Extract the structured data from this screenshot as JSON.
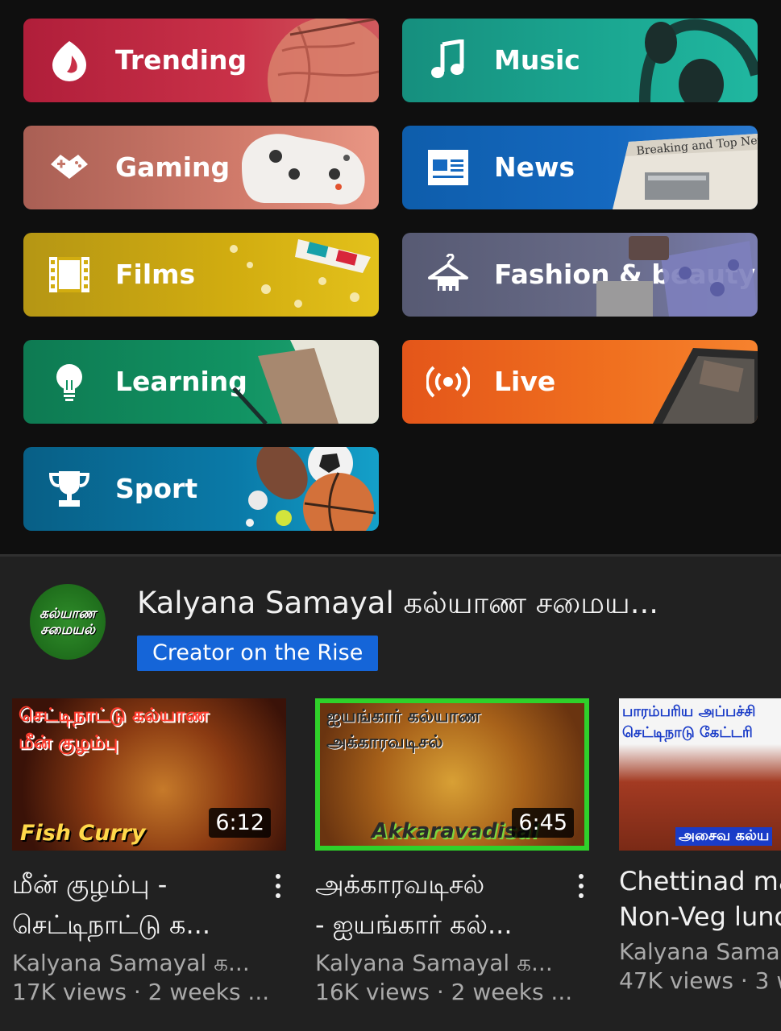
{
  "explore": {
    "tiles": [
      {
        "label": "Trending",
        "icon": "trending-flame-icon"
      },
      {
        "label": "Music",
        "icon": "music-note-icon"
      },
      {
        "label": "Gaming",
        "icon": "gamepad-icon"
      },
      {
        "label": "News",
        "icon": "newspaper-icon"
      },
      {
        "label": "Films",
        "icon": "film-strip-icon"
      },
      {
        "label": "Fashion & beauty",
        "icon": "hanger-icon"
      },
      {
        "label": "Learning",
        "icon": "lightbulb-icon"
      },
      {
        "label": "Live",
        "icon": "live-broadcast-icon"
      },
      {
        "label": "Sport",
        "icon": "trophy-icon"
      }
    ],
    "news_art_text": "Breaking and Top News"
  },
  "channel": {
    "avatar_text_1": "கல்யாண",
    "avatar_text_2": "சமையல்",
    "name": "Kalyana Samayal கல்யாண சமைய...",
    "badge": "Creator on the Rise"
  },
  "videos": [
    {
      "thumb_text_1": "செட்டிநாட்டு கல்யாண",
      "thumb_text_2": "மீன் குழம்பு",
      "thumb_text_3": "Fish Curry",
      "duration": "6:12",
      "title_line1": "மீன் குழம்பு -",
      "title_line2": "செட்டிநாட்டு க...",
      "channel": "Kalyana Samayal க...",
      "stats": "17K views · 2 weeks ..."
    },
    {
      "thumb_text_1": "ஐயங்கார் கல்யாண",
      "thumb_text_2": "அக்காரவடிசல்",
      "thumb_text_3": "Akkaravadisal",
      "duration": "6:45",
      "title_line1": "அக்காரவடிசல்",
      "title_line2": "- ஐயங்கார் கல்...",
      "channel": "Kalyana Samayal க...",
      "stats": "16K views · 2 weeks ..."
    },
    {
      "thumb_text_1": "பாரம்பரிய அப்பச்சி",
      "thumb_text_2": "செட்டிநாடு கேட்டரி",
      "thumb_text_3": "அசைவ கல்ய",
      "title_line1": "Chettinad ma",
      "title_line2": "Non-Veg lunc",
      "channel": "Kalyana Sama",
      "stats": "47K views · 3 w"
    }
  ]
}
